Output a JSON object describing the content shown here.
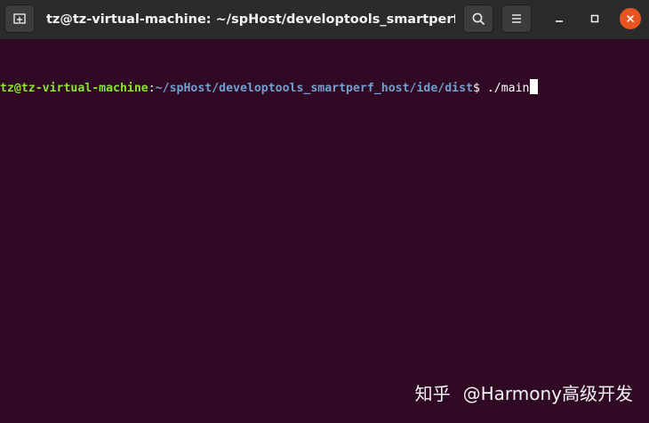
{
  "window": {
    "title": "tz@tz-virtual-machine: ~/spHost/developtools_smartperf_h..."
  },
  "titlebar": {
    "new_tab_icon": "new-tab-icon",
    "search_icon": "search-icon",
    "menu_icon": "hamburger-menu-icon",
    "minimize_icon": "minimize-icon",
    "maximize_icon": "maximize-icon",
    "close_icon": "close-icon"
  },
  "terminal": {
    "line1": {
      "user_host": "tz@tz-virtual-machine",
      "separator": ":",
      "path": "~/spHost/developtools_smartperf_host/ide/dist",
      "prompt": "$ ",
      "command": "./main"
    }
  },
  "watermark": {
    "site": "知乎",
    "author": "@Harmony高级开发"
  },
  "colors": {
    "titlebar_bg": "#2b2b2b",
    "terminal_bg": "#300a24",
    "user_host": "#8ae234",
    "path": "#729fcf",
    "close_button": "#e95420"
  }
}
